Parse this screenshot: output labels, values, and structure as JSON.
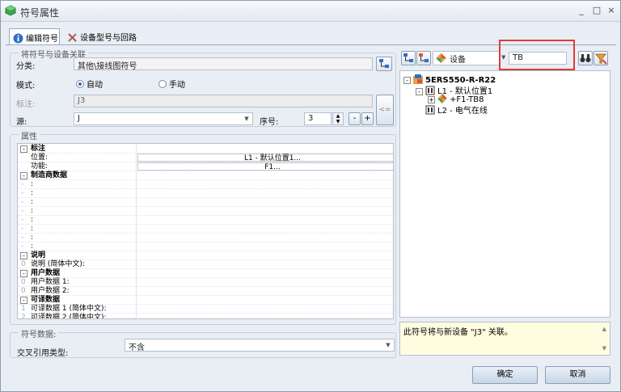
{
  "window": {
    "title": "符号属性",
    "min": "_",
    "max": "□",
    "close": "×"
  },
  "tabs": [
    {
      "label": "编辑符号"
    },
    {
      "label": "设备型号与回路"
    }
  ],
  "assoc": {
    "group_title": "将符号与设备关联",
    "category_label": "分类:",
    "category_value": "其他\\接线图符号",
    "mode_label": "模式:",
    "mode_auto": "自动",
    "mode_manual": "手动",
    "tag_label": "标注:",
    "tag_value": "J3",
    "source_label": "源:",
    "source_value": "J",
    "seq_label": "序号:",
    "seq_value": "3",
    "minus": "-",
    "plus": "+",
    "side": "<="
  },
  "props": {
    "group_title": "属性",
    "rows": [
      {
        "type": "cat",
        "label": "标注"
      },
      {
        "type": "item",
        "idx": "",
        "name": "位置:",
        "value": "L1 - 默认位置1..."
      },
      {
        "type": "item",
        "idx": "",
        "name": "功能:",
        "value": "F1..."
      },
      {
        "type": "cat",
        "label": "制造商数据"
      },
      {
        "type": "blank",
        "idx": "-",
        "name": ":",
        "dots": "..."
      },
      {
        "type": "blank",
        "idx": "-",
        "name": ":",
        "dots": "..."
      },
      {
        "type": "blank",
        "idx": "-",
        "name": ":",
        "dots": "..."
      },
      {
        "type": "blank",
        "idx": "-",
        "name": ":",
        "dots": "..."
      },
      {
        "type": "blank",
        "idx": "-",
        "name": ":",
        "dots": "..."
      },
      {
        "type": "blank",
        "idx": "-",
        "name": ":",
        "dots": "..."
      },
      {
        "type": "blank",
        "idx": "-",
        "name": ":",
        "dots": "..."
      },
      {
        "type": "blank",
        "idx": "-",
        "name": ":",
        "dots": "..."
      },
      {
        "type": "cat",
        "label": "说明"
      },
      {
        "type": "blank",
        "idx": "0",
        "name": "说明 (简体中文):",
        "dots": "..."
      },
      {
        "type": "cat",
        "label": "用户数据"
      },
      {
        "type": "blank",
        "idx": "0",
        "name": "用户数据 1:",
        "dots": "..."
      },
      {
        "type": "blank",
        "idx": "0",
        "name": "用户数据 2:",
        "dots": "..."
      },
      {
        "type": "cat",
        "label": "可译数据"
      },
      {
        "type": "blank",
        "idx": "1",
        "name": "可译数据 1 (简体中文):",
        "dots": "..."
      },
      {
        "type": "blank",
        "idx": "2",
        "name": "可译数据 2 (简体中文):",
        "dots": "..."
      }
    ]
  },
  "symdata": {
    "group_title": "符号数据:",
    "xref_label": "交叉引用类型:",
    "xref_value": "不含"
  },
  "right": {
    "device_combo": "设备",
    "search_value": "TB",
    "tree": [
      {
        "label": "5ERS550-R-R22",
        "level": 0
      },
      {
        "label": "L1 - 默认位置1",
        "level": 1
      },
      {
        "label": "+F1-TB8",
        "level": 2
      },
      {
        "label": "L2 - 电气在线",
        "level": 1
      }
    ],
    "message": "此符号将与新设备 \"J3\" 关联。"
  },
  "footer": {
    "ok": "确定",
    "cancel": "取消"
  },
  "colors": {
    "annotation": "#e23b3b"
  }
}
